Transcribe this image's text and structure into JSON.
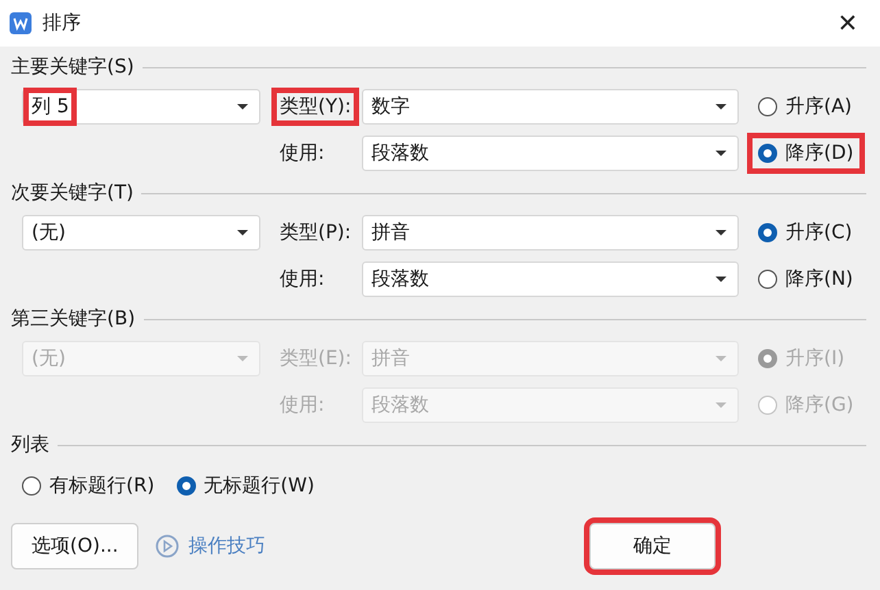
{
  "window": {
    "title": "排序",
    "close": "✕"
  },
  "sections": [
    {
      "title": "主要关键字(S)",
      "disabled": false,
      "key": {
        "value": "列 5",
        "highlighted": true
      },
      "type_label": "类型(Y):",
      "type_highlighted": true,
      "type": "数字",
      "use_label": "使用:",
      "use": "段落数",
      "orders": [
        {
          "label": "升序(A)",
          "selected": false,
          "highlighted": false
        },
        {
          "label": "降序(D)",
          "selected": true,
          "highlighted": true
        }
      ]
    },
    {
      "title": "次要关键字(T)",
      "disabled": false,
      "key": {
        "value": "(无)",
        "highlighted": false
      },
      "type_label": "类型(P):",
      "type_highlighted": false,
      "type": "拼音",
      "use_label": "使用:",
      "use": "段落数",
      "orders": [
        {
          "label": "升序(C)",
          "selected": true,
          "highlighted": false
        },
        {
          "label": "降序(N)",
          "selected": false,
          "highlighted": false
        }
      ]
    },
    {
      "title": "第三关键字(B)",
      "disabled": true,
      "key": {
        "value": "(无)",
        "highlighted": false
      },
      "type_label": "类型(E):",
      "type_highlighted": false,
      "type": "拼音",
      "use_label": "使用:",
      "use": "段落数",
      "orders": [
        {
          "label": "升序(I)",
          "selected": true,
          "highlighted": false
        },
        {
          "label": "降序(G)",
          "selected": false,
          "highlighted": false
        }
      ]
    }
  ],
  "list": {
    "title": "列表",
    "options": [
      {
        "label": "有标题行(R)",
        "selected": false
      },
      {
        "label": "无标题行(W)",
        "selected": true
      }
    ]
  },
  "footer": {
    "options_button": "选项(O)...",
    "tips_link": "操作技巧",
    "ok_button": {
      "label": "确定",
      "highlighted": true
    }
  }
}
